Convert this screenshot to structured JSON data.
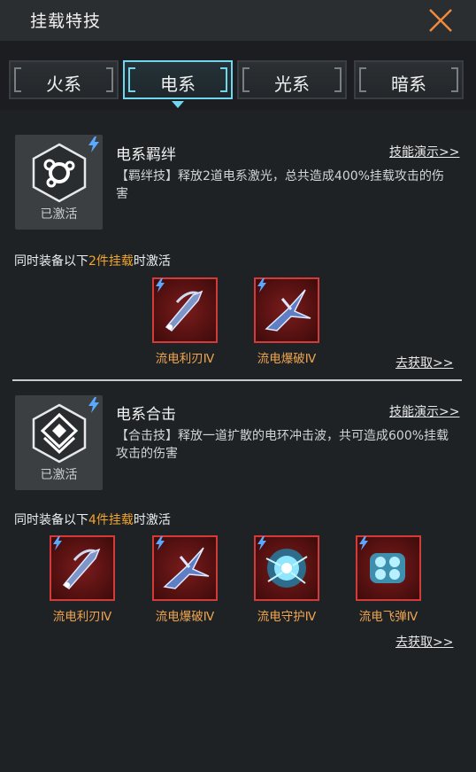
{
  "header": {
    "title": "挂载特技"
  },
  "tabs": [
    {
      "label": "火系",
      "active": false
    },
    {
      "label": "电系",
      "active": true
    },
    {
      "label": "光系",
      "active": false
    },
    {
      "label": "暗系",
      "active": false
    }
  ],
  "sections": [
    {
      "status": "已激活",
      "name": "电系羁绊",
      "demo_link": "技能演示>>",
      "desc": "【羁绊技】释放2道电系激光，总共造成400%挂载攻击的伤害",
      "cond_prefix": "同时装备以下",
      "cond_highlight": "2件挂载",
      "cond_suffix": "时激活",
      "items": [
        "流电利刃Ⅳ",
        "流电爆破Ⅳ"
      ],
      "get_link": "去获取>>"
    },
    {
      "status": "已激活",
      "name": "电系合击",
      "demo_link": "技能演示>>",
      "desc": "【合击技】释放一道扩散的电环冲击波，共可造成600%挂载攻击的伤害",
      "cond_prefix": "同时装备以下",
      "cond_highlight": "4件挂载",
      "cond_suffix": "时激活",
      "items": [
        "流电利刃Ⅳ",
        "流电爆破Ⅳ",
        "流电守护Ⅳ",
        "流电飞弹Ⅳ"
      ],
      "get_link": "去获取>>"
    }
  ],
  "colors": {
    "accent": "#6fd6ee",
    "highlight": "#f0a52a",
    "item_name": "#f0a550",
    "item_border": "#d33b3b"
  }
}
